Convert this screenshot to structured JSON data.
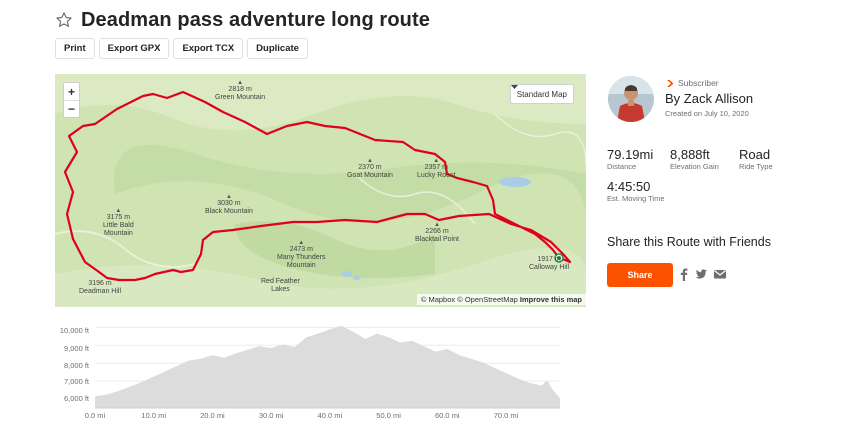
{
  "route": {
    "title": "Deadman pass adventure long route"
  },
  "actions": [
    "Print",
    "Export GPX",
    "Export TCX",
    "Duplicate"
  ],
  "map": {
    "style_label": "Standard Map",
    "zoom_in": "+",
    "zoom_out": "−",
    "labels": {
      "green_mountain": "Green Mountain",
      "green_mountain_elev": "2818 m",
      "goat_mountain": "Goat Mountain",
      "goat_mountain_elev": "2370 m",
      "lucky_roost": "Lucky Roost",
      "lucky_roost_elev": "2357 m",
      "black_mountain": "Black Mountain",
      "black_mountain_elev": "3030 m",
      "little_bald": "Little Bald\nMountain",
      "little_bald_elev": "3175 m",
      "blacktail_point": "Blacktail Point",
      "blacktail_point_elev": "2266 m",
      "many_thunders": "Many Thunders\nMountain",
      "many_thunders_elev": "2473 m",
      "red_feather": "Red Feather\nLakes",
      "deadman_hill": "Deadman Hill",
      "deadman_hill_elev": "3196 m",
      "calloway_hill": "Calloway Hill",
      "calloway_hill_elev": "1917 m"
    },
    "attribution_mapbox": "© Mapbox",
    "attribution_osm": "© OpenStreetMap",
    "attribution_improve": "Improve this map"
  },
  "author": {
    "badge": "Subscriber",
    "name": "By Zack Allison",
    "created": "Created on July 10, 2020"
  },
  "stats": {
    "distance": {
      "value": "79.19mi",
      "label": "Distance"
    },
    "elevation": {
      "value": "8,888ft",
      "label": "Elevation Gain"
    },
    "type": {
      "value": "Road",
      "label": "Ride Type"
    },
    "time": {
      "value": "4:45:50",
      "label": "Est. Moving Time"
    }
  },
  "share": {
    "title": "Share this Route with Friends",
    "button": "Share"
  },
  "colors": {
    "brand": "#fc5200",
    "route": "#e0001b",
    "elevation_fill": "#dcdcdc"
  },
  "elevation_profile": {
    "y_ticks": [
      "10,000 ft",
      "9,000 ft",
      "8,000 ft",
      "7,000 ft",
      "6,000 ft"
    ],
    "x_ticks": [
      "0.0 mi",
      "10.0 mi",
      "20.0 mi",
      "30.0 mi",
      "40.0 mi",
      "50.0 mi",
      "60.0 mi",
      "70.0 mi"
    ],
    "x_max_mi": 79.19,
    "y_min_ft": 5500,
    "y_max_ft": 10300,
    "points_mi_ft": [
      [
        0,
        6150
      ],
      [
        2,
        6250
      ],
      [
        4,
        6450
      ],
      [
        6,
        6700
      ],
      [
        8,
        6950
      ],
      [
        10,
        7250
      ],
      [
        12,
        7550
      ],
      [
        14,
        7850
      ],
      [
        16,
        8150
      ],
      [
        18,
        8250
      ],
      [
        20,
        8450
      ],
      [
        22,
        8300
      ],
      [
        24,
        8550
      ],
      [
        26,
        8750
      ],
      [
        28,
        8950
      ],
      [
        30,
        8850
      ],
      [
        32,
        9050
      ],
      [
        34,
        8900
      ],
      [
        36,
        9450
      ],
      [
        38,
        9650
      ],
      [
        40,
        9900
      ],
      [
        42,
        10100
      ],
      [
        44,
        9750
      ],
      [
        46,
        9350
      ],
      [
        48,
        9650
      ],
      [
        50,
        9450
      ],
      [
        52,
        9150
      ],
      [
        54,
        9250
      ],
      [
        56,
        8950
      ],
      [
        58,
        8650
      ],
      [
        60,
        8800
      ],
      [
        62,
        8450
      ],
      [
        64,
        8250
      ],
      [
        66,
        8050
      ],
      [
        68,
        7750
      ],
      [
        70,
        7450
      ],
      [
        72,
        7150
      ],
      [
        74,
        6900
      ],
      [
        76,
        6750
      ],
      [
        77,
        7050
      ],
      [
        78,
        6500
      ],
      [
        79.19,
        6050
      ]
    ]
  }
}
